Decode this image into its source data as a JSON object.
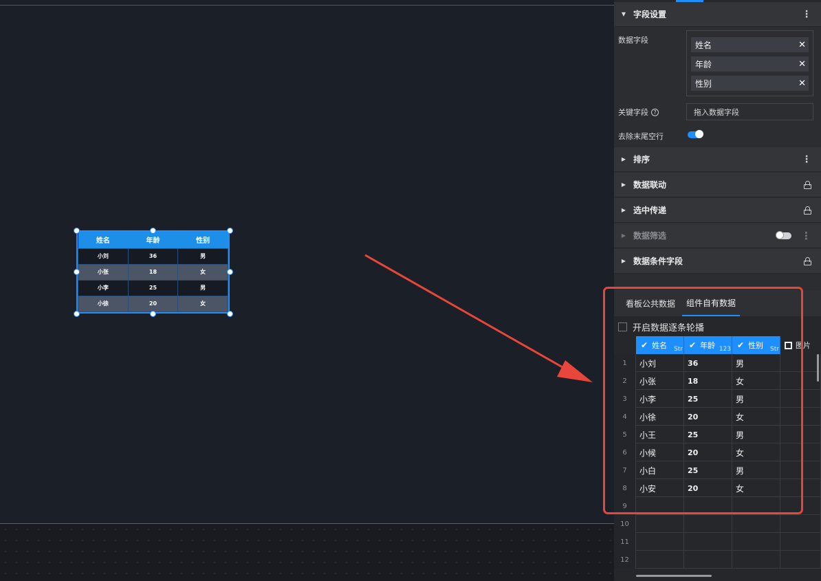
{
  "canvas": {
    "widget_table": {
      "headers": [
        "姓名",
        "年龄",
        "性别"
      ],
      "rows": [
        [
          "小刘",
          "36",
          "男"
        ],
        [
          "小张",
          "18",
          "女"
        ],
        [
          "小李",
          "25",
          "男"
        ],
        [
          "小徐",
          "20",
          "女"
        ]
      ]
    }
  },
  "panel": {
    "field_settings": {
      "title": "字段设置",
      "data_fields_label": "数据字段",
      "fields": [
        "姓名",
        "年龄",
        "性别"
      ],
      "key_field_label": "关键字段",
      "key_field_placeholder": "拖入数据字段",
      "trim_rows_label": "去除末尾空行",
      "trim_rows_enabled": true
    },
    "sections": [
      {
        "title": "排序",
        "right": "more"
      },
      {
        "title": "数据联动",
        "right": "lock"
      },
      {
        "title": "选中传递",
        "right": "lock"
      },
      {
        "title": "数据筛选",
        "right": "toggle-more",
        "dim": true
      },
      {
        "title": "数据条件字段",
        "right": "lock"
      }
    ],
    "data": {
      "tabs": [
        "看板公共数据",
        "组件自有数据"
      ],
      "active_tab": 1,
      "carousel_label": "开启数据逐条轮播",
      "columns": [
        {
          "name": "姓名",
          "type": "Str",
          "checked": true
        },
        {
          "name": "年龄",
          "type": "123",
          "checked": true
        },
        {
          "name": "性别",
          "type": "Str",
          "checked": true
        },
        {
          "name": "图片",
          "type": "",
          "checked": false
        }
      ],
      "rows": [
        {
          "n": "1",
          "c": [
            "小刘",
            "36",
            "男"
          ]
        },
        {
          "n": "2",
          "c": [
            "小张",
            "18",
            "女"
          ]
        },
        {
          "n": "3",
          "c": [
            "小李",
            "25",
            "男"
          ]
        },
        {
          "n": "4",
          "c": [
            "小徐",
            "20",
            "女"
          ]
        },
        {
          "n": "5",
          "c": [
            "小王",
            "25",
            "男"
          ]
        },
        {
          "n": "6",
          "c": [
            "小候",
            "20",
            "女"
          ]
        },
        {
          "n": "7",
          "c": [
            "小白",
            "25",
            "男"
          ]
        },
        {
          "n": "8",
          "c": [
            "小安",
            "20",
            "女"
          ]
        },
        {
          "n": "9",
          "c": [
            "",
            "",
            ""
          ]
        },
        {
          "n": "10",
          "c": [
            "",
            "",
            ""
          ]
        },
        {
          "n": "11",
          "c": [
            "",
            "",
            ""
          ]
        },
        {
          "n": "12",
          "c": [
            "",
            "",
            ""
          ]
        }
      ]
    }
  },
  "colors": {
    "accent": "#1e8fff",
    "highlight": "#e8463a"
  }
}
